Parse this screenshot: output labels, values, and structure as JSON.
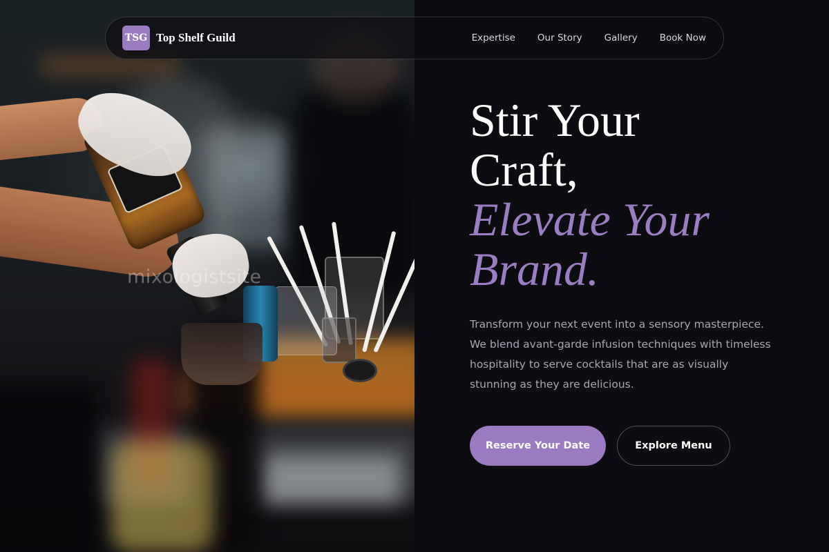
{
  "brand": {
    "logo_text": "TSG",
    "name": "Top Shelf Guild"
  },
  "nav": {
    "links": [
      "Expertise",
      "Our Story",
      "Gallery",
      "Book Now"
    ]
  },
  "hero": {
    "headline_line1": "Stir Your",
    "headline_line2": "Craft,",
    "headline_accent1": "Elevate Your",
    "headline_accent2": "Brand.",
    "description": "Transform your next event into a sensory masterpiece. We blend avant-garde infusion techniques with timeless hospitality to serve cocktails that are as visually stunning as they are delicious.",
    "primary_cta": "Reserve Your Date",
    "secondary_cta": "Explore Menu"
  },
  "photo": {
    "watermark": "mixologistsite"
  },
  "colors": {
    "background": "#0d0c10",
    "accent": "#9a7ac0",
    "accent_text": "#9b7dc2",
    "body_text": "#a9a6b4"
  }
}
